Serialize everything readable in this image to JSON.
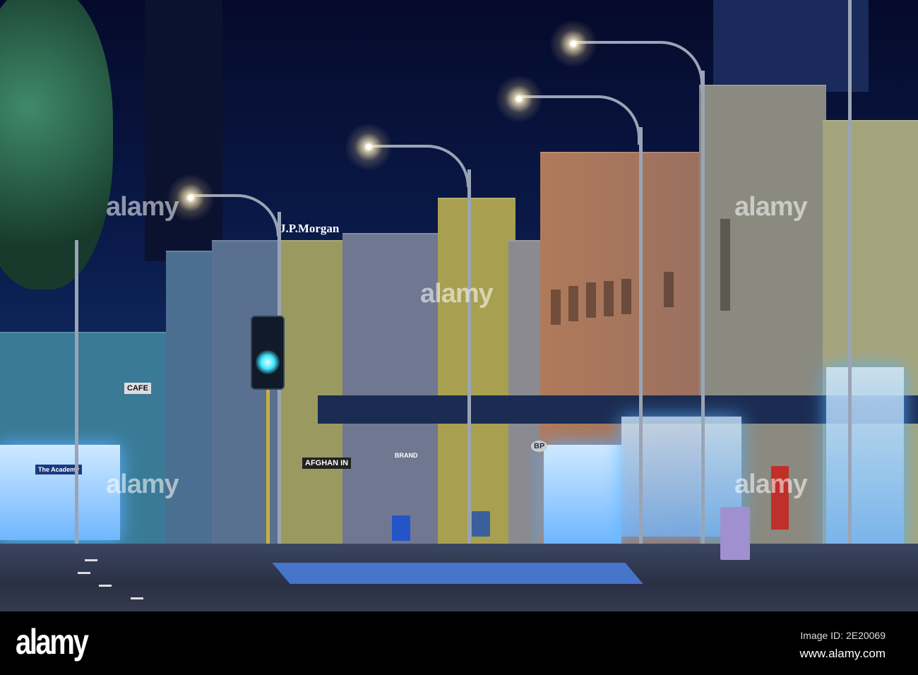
{
  "photo": {
    "signs": {
      "jpmorgan": "J.P.Morgan",
      "afghan": "AFGHAN IN",
      "cafe": "CAFE",
      "academy": "The Academy",
      "brand": "BRAND",
      "bp": "BP"
    },
    "watermarks": [
      "alamy",
      "alamy",
      "alamy",
      "alamy",
      "alamy"
    ]
  },
  "footer": {
    "logo": "alamy",
    "image_id": "Image ID: 2E20069",
    "url": "www.alamy.com"
  },
  "colors": {
    "sky": "#0a1a4a",
    "traffic_light": "#3fe6ff",
    "shop_glow": "#6fb6ff"
  }
}
